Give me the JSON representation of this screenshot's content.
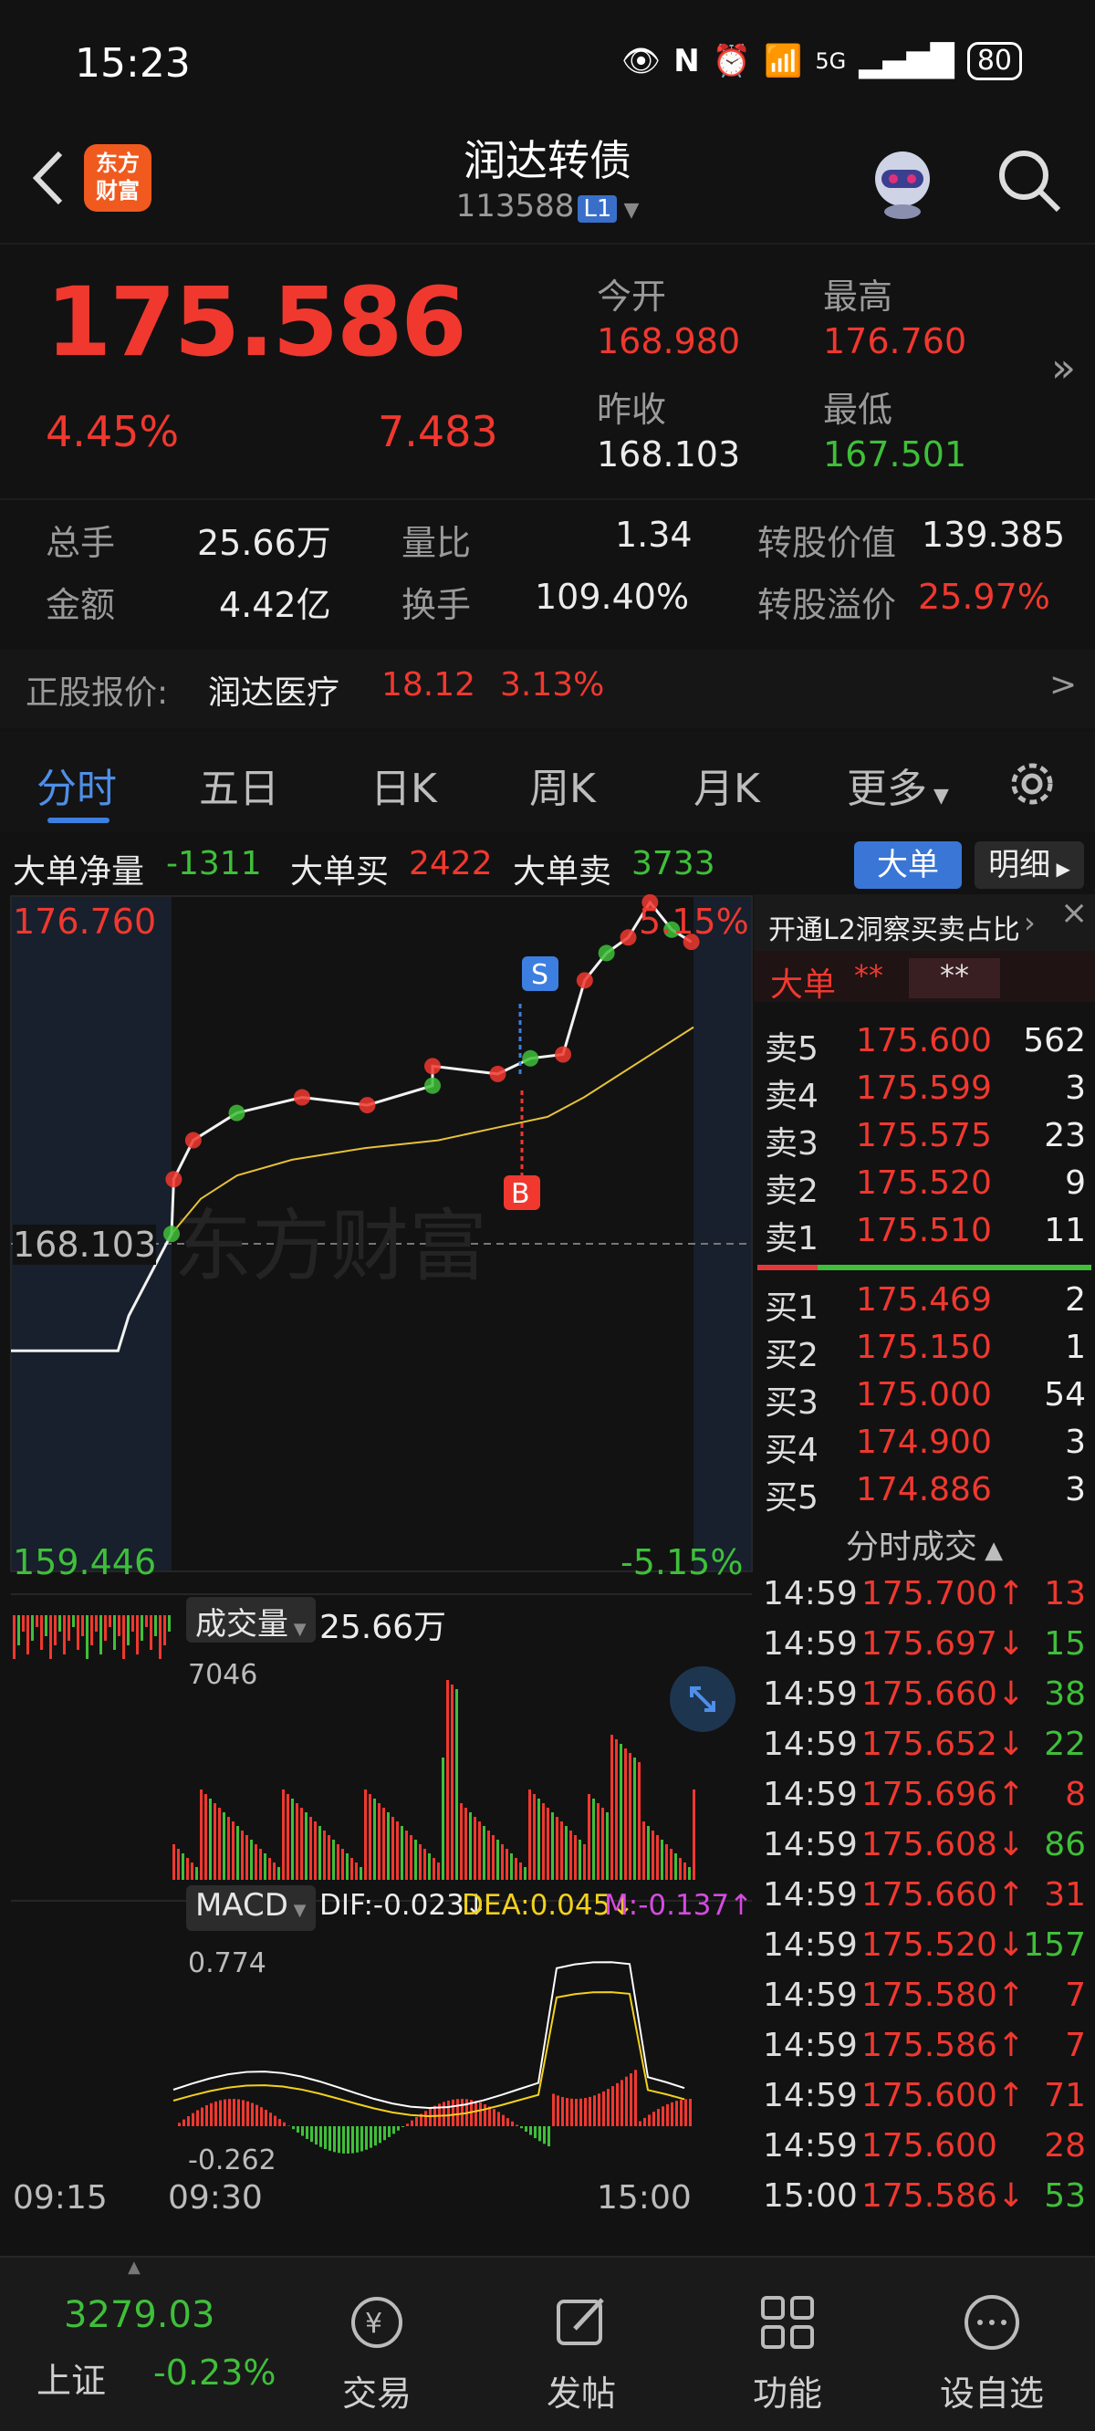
{
  "status": {
    "time": "15:23",
    "network": "5G",
    "battery": "80"
  },
  "nav": {
    "title": "润达转债",
    "code": "113588",
    "level": "L1",
    "logo": "东方\n财富"
  },
  "quote": {
    "price": "175.586",
    "change_pct": "4.45%",
    "change": "7.483",
    "open_label": "今开",
    "open": "168.980",
    "high_label": "最高",
    "high": "176.760",
    "prev_close_label": "昨收",
    "prev_close": "168.103",
    "low_label": "最低",
    "low": "167.501"
  },
  "stats": {
    "volume_label": "总手",
    "volume": "25.66万",
    "vol_ratio_label": "量比",
    "vol_ratio": "1.34",
    "conv_value_label": "转股价值",
    "conv_value": "139.385",
    "amount_label": "金额",
    "amount": "4.42亿",
    "turnover_label": "换手",
    "turnover": "109.40%",
    "premium_label": "转股溢价",
    "premium": "25.97%"
  },
  "underlying": {
    "label": "正股报价:",
    "name": "润达医疗",
    "price": "18.12",
    "pct": "3.13%",
    "arrow": ">"
  },
  "tabs": [
    "分时",
    "五日",
    "日K",
    "周K",
    "月K",
    "更多"
  ],
  "big_order": {
    "net_label": "大单净量",
    "net": "-1311",
    "buy_label": "大单买",
    "buy": "2422",
    "sell_label": "大单卖",
    "sell": "3733",
    "btn_big": "大单",
    "btn_detail": "明细"
  },
  "chart": {
    "top_price": "176.760",
    "top_pct": "5.15%",
    "mid_price": "168.103",
    "bottom_price": "159.446",
    "bottom_pct": "-5.15%",
    "watermark": "东方财富",
    "marker_s": "S",
    "marker_b": "B",
    "vol_label": "成交量",
    "vol_total": "25.66万",
    "vol_max": "7046",
    "macd_label": "MACD",
    "dif": "DIF:-0.023↓",
    "dea": "DEA:0.045↓",
    "m": "M:-0.137↑",
    "macd_max": "0.774",
    "macd_min": "-0.262",
    "time_start": "09:15",
    "time_open": "09:30",
    "time_end": "15:00"
  },
  "chart_data": {
    "type": "line",
    "title": "",
    "x_ticks": [
      "09:15",
      "09:30",
      "15:00"
    ],
    "ylim": [
      159.446,
      176.76
    ],
    "prev_close": 168.103,
    "series": [
      {
        "x": [
          "09:15",
          "09:25",
          "09:26",
          "09:30",
          "09:31",
          "09:40",
          "10:00",
          "10:30",
          "11:00",
          "11:30",
          "13:00",
          "13:30",
          "13:45",
          "14:00",
          "14:10",
          "14:20",
          "14:30",
          "14:40",
          "14:50",
          "14:59"
        ],
        "values": [
          165.1,
          165.1,
          166.0,
          168.1,
          169.5,
          170.5,
          171.2,
          171.6,
          171.4,
          171.9,
          172.4,
          172.2,
          172.6,
          172.7,
          174.6,
          175.3,
          175.7,
          176.6,
          175.9,
          175.586
        ]
      }
    ]
  },
  "panel": {
    "header": "开通L2洞察买卖占比",
    "big_label": "大单",
    "big_v1": "**",
    "big_v2": "**",
    "sells": [
      {
        "label": "卖5",
        "price": "175.600",
        "qty": "562"
      },
      {
        "label": "卖4",
        "price": "175.599",
        "qty": "3"
      },
      {
        "label": "卖3",
        "price": "175.575",
        "qty": "23"
      },
      {
        "label": "卖2",
        "price": "175.520",
        "qty": "9"
      },
      {
        "label": "卖1",
        "price": "175.510",
        "qty": "11"
      }
    ],
    "buys": [
      {
        "label": "买1",
        "price": "175.469",
        "qty": "2"
      },
      {
        "label": "买2",
        "price": "175.150",
        "qty": "1"
      },
      {
        "label": "买3",
        "price": "175.000",
        "qty": "54"
      },
      {
        "label": "买4",
        "price": "174.900",
        "qty": "3"
      },
      {
        "label": "买5",
        "price": "174.886",
        "qty": "3"
      }
    ],
    "trades_label": "分时成交",
    "trades": [
      {
        "time": "14:59",
        "price": "175.700↑",
        "qty": "13",
        "dir": "up"
      },
      {
        "time": "14:59",
        "price": "175.697↓",
        "qty": "15",
        "dir": "down"
      },
      {
        "time": "14:59",
        "price": "175.660↓",
        "qty": "38",
        "dir": "down"
      },
      {
        "time": "14:59",
        "price": "175.652↓",
        "qty": "22",
        "dir": "down"
      },
      {
        "time": "14:59",
        "price": "175.696↑",
        "qty": "8",
        "dir": "up"
      },
      {
        "time": "14:59",
        "price": "175.608↓",
        "qty": "86",
        "dir": "down"
      },
      {
        "time": "14:59",
        "price": "175.660↑",
        "qty": "31",
        "dir": "up"
      },
      {
        "time": "14:59",
        "price": "175.520↓",
        "qty": "157",
        "dir": "down"
      },
      {
        "time": "14:59",
        "price": "175.580↑",
        "qty": "7",
        "dir": "up"
      },
      {
        "time": "14:59",
        "price": "175.586↑",
        "qty": "7",
        "dir": "up"
      },
      {
        "time": "14:59",
        "price": "175.600↑",
        "qty": "71",
        "dir": "up"
      },
      {
        "time": "14:59",
        "price": "175.600",
        "qty": "28",
        "dir": "flat"
      },
      {
        "time": "15:00",
        "price": "175.586↓",
        "qty": "53",
        "dir": "down"
      }
    ]
  },
  "bottom": {
    "index_value": "3279.03",
    "index_name": "上证",
    "index_pct": "-0.23%",
    "trade": "交易",
    "post": "发帖",
    "func": "功能",
    "watch": "设自选"
  },
  "colors": {
    "up": "#f0382f",
    "down": "#3fbf3a",
    "accent": "#3d7fe0",
    "avg_line": "#e6c23a"
  }
}
